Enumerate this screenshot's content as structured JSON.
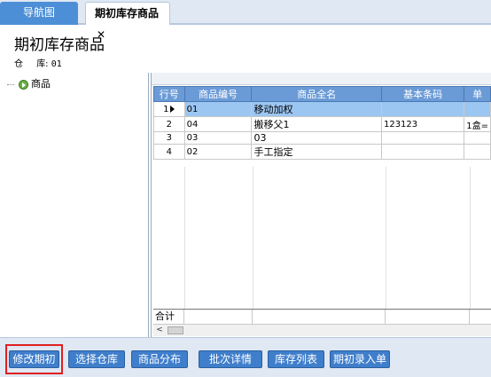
{
  "tabs": {
    "nav_label": "导航图",
    "active_label": "期初库存商品",
    "close_glyph": "✕"
  },
  "header": {
    "title": "期初库存商品",
    "warehouse_label_1": "仓",
    "warehouse_label_2": "库:",
    "warehouse_value": "01"
  },
  "tree": {
    "root_label": "商品",
    "icon": "goods-node-icon"
  },
  "grid": {
    "columns": [
      "行号",
      "商品编号",
      "商品全名",
      "基本条码",
      "单"
    ],
    "rows": [
      {
        "row": "1",
        "code": "01",
        "name": "移动加权",
        "barcode": "",
        "unit": ""
      },
      {
        "row": "2",
        "code": "04",
        "name": "搬移父1",
        "barcode": "123123",
        "unit": "1盒="
      },
      {
        "row": "3",
        "code": "03",
        "name": "03",
        "barcode": "",
        "unit": ""
      },
      {
        "row": "4",
        "code": "02",
        "name": "手工指定",
        "barcode": "",
        "unit": ""
      }
    ],
    "selected_row": 1,
    "footer_label": "合计",
    "scroll_left_glyph": "<"
  },
  "buttons": {
    "modify_initial": "修改期初",
    "select_warehouse": "选择仓库",
    "goods_distribution": "商品分布",
    "batch_details": "批次详情",
    "inventory_list": "库存列表",
    "initial_entry": "期初录入单"
  },
  "colors": {
    "header_blue": "#6b9bd6",
    "selected_row": "#9cc6f2",
    "button_blue": "#3f7ecb",
    "highlight_red": "#e02020"
  }
}
